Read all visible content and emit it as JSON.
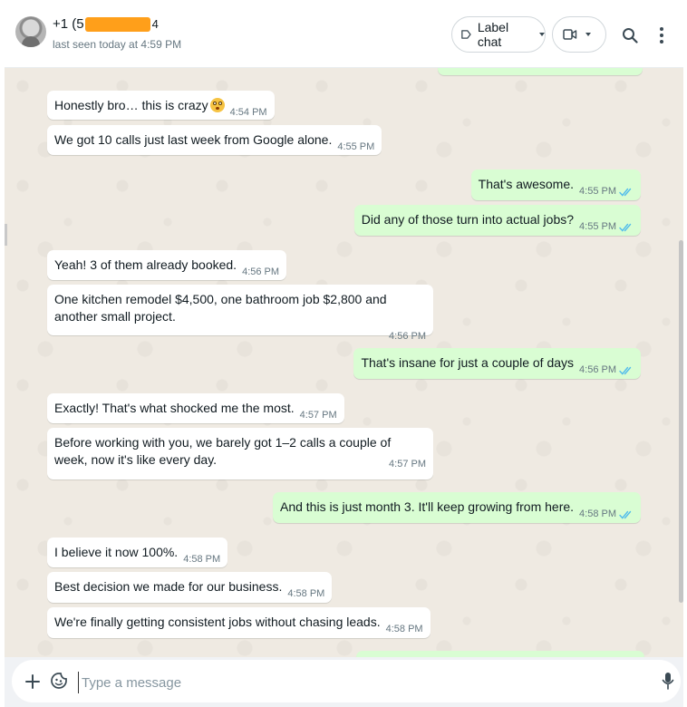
{
  "header": {
    "name_prefix": "+1 (5",
    "name_suffix": "4",
    "last_seen": "last seen today at 4:59 PM",
    "label_button": "Label chat"
  },
  "messages": [
    {
      "dir": "in",
      "text": "Honestly bro… this is crazy",
      "emoji": "flushed-face",
      "time": "4:54 PM"
    },
    {
      "dir": "in",
      "text": "We got 10 calls just last week from Google alone.",
      "time": "4:55 PM"
    },
    {
      "dir": "out",
      "text": "That's awesome.",
      "time": "4:55 PM"
    },
    {
      "dir": "out",
      "text": "Did any of those turn into actual jobs?",
      "time": "4:55 PM"
    },
    {
      "dir": "in",
      "text": "Yeah! 3 of them already booked.",
      "time": "4:56 PM"
    },
    {
      "dir": "in",
      "text": "One kitchen remodel $4,500, one bathroom job $2,800 and another small project.",
      "time": "4:56 PM"
    },
    {
      "dir": "out",
      "text": "That's insane for just a couple of days",
      "time": "4:56 PM"
    },
    {
      "dir": "in",
      "text": "Exactly! That's what shocked me the most.",
      "time": "4:57 PM"
    },
    {
      "dir": "in",
      "text": "Before working with you, we barely got 1–2 calls a couple of week, now it's like every day.",
      "time": "4:57 PM"
    },
    {
      "dir": "out",
      "text": "And this is just month 3. It'll keep growing from here.",
      "time": "4:58 PM"
    },
    {
      "dir": "in",
      "text": "I believe it now 100%.",
      "time": "4:58 PM"
    },
    {
      "dir": "in",
      "text": "Best decision we made for our business.",
      "time": "4:58 PM"
    },
    {
      "dir": "in",
      "text": "We're finally getting consistent jobs without chasing leads.",
      "time": "4:58 PM"
    }
  ],
  "composer": {
    "placeholder": "Type a message"
  },
  "colors": {
    "incoming": "#ffffff",
    "outgoing": "#d9fdd3",
    "chat_background": "#efeae2",
    "read_ticks": "#53bdeb",
    "redaction": "#ff9f1a"
  }
}
